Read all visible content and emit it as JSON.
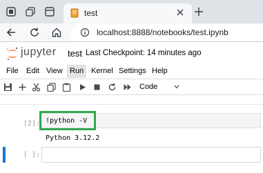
{
  "browser": {
    "tab": {
      "title": "test",
      "favicon": "notebook-icon"
    },
    "url": "localhost:8888/notebooks/test.ipynb",
    "icons": [
      "workspaces-icon",
      "tab-actions-icon",
      "tab-grid-icon",
      "close-icon",
      "new-tab-icon",
      "back-icon",
      "refresh-icon",
      "home-icon",
      "site-info-icon"
    ]
  },
  "jupyter": {
    "wordmark": "jupyter",
    "notebook_name": "test",
    "checkpoint": "Last Checkpoint: 14 minutes ago",
    "menu": [
      "File",
      "Edit",
      "View",
      "Run",
      "Kernel",
      "Settings",
      "Help"
    ],
    "active_menu": "Run",
    "cell_type": "Code",
    "toolbar_icons": [
      "save-icon",
      "add-cell-icon",
      "cut-icon",
      "copy-icon",
      "paste-icon",
      "run-icon",
      "stop-icon",
      "restart-icon",
      "run-all-icon",
      "chevron-down-icon"
    ]
  },
  "cells": [
    {
      "prompt": "[2]:",
      "source": "!python -V",
      "output": "Python 3.12.2"
    },
    {
      "prompt": "[ ]:",
      "source": ""
    }
  ],
  "colors": {
    "highlight": "#2fa84f",
    "active_cell": "#1976d2",
    "logo_orange": "#f37726"
  }
}
